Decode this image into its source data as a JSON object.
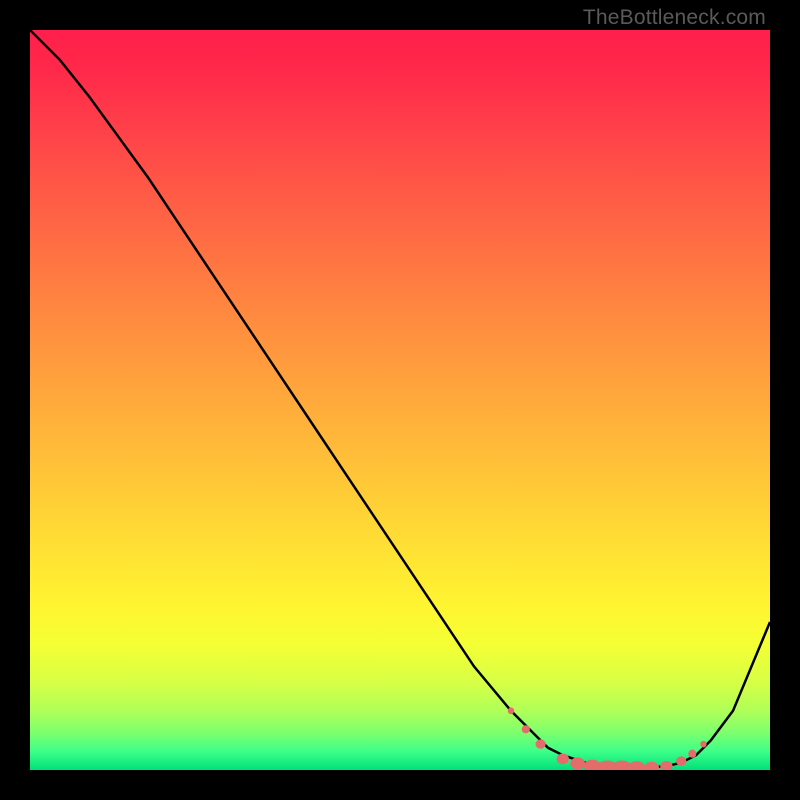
{
  "watermark": "TheBottleneck.com",
  "chart_data": {
    "type": "line",
    "title": "",
    "xlabel": "",
    "ylabel": "",
    "xlim": [
      0,
      100
    ],
    "ylim": [
      0,
      100
    ],
    "grid": false,
    "legend": false,
    "series": [
      {
        "name": "curve",
        "x": [
          0,
          4,
          8,
          12,
          16,
          20,
          28,
          36,
          44,
          52,
          60,
          65,
          68,
          70,
          72,
          75,
          78,
          80,
          83,
          86,
          88,
          90,
          92,
          95,
          100
        ],
        "y": [
          100,
          96,
          91,
          85.5,
          80,
          74,
          62,
          50,
          38,
          26,
          14,
          8,
          5,
          3,
          2,
          1,
          0.5,
          0.3,
          0.3,
          0.5,
          1,
          2,
          4,
          8,
          20
        ]
      }
    ],
    "markers": [
      {
        "x": 65,
        "y": 8
      },
      {
        "x": 67,
        "y": 5.5
      },
      {
        "x": 69,
        "y": 3.5
      },
      {
        "x": 72,
        "y": 1.5
      },
      {
        "x": 74,
        "y": 0.9
      },
      {
        "x": 76,
        "y": 0.5
      },
      {
        "x": 78,
        "y": 0.3
      },
      {
        "x": 80,
        "y": 0.3
      },
      {
        "x": 82,
        "y": 0.3
      },
      {
        "x": 84,
        "y": 0.3
      },
      {
        "x": 86,
        "y": 0.5
      },
      {
        "x": 88,
        "y": 1.2
      },
      {
        "x": 89.5,
        "y": 2.2
      },
      {
        "x": 91,
        "y": 3.5
      }
    ],
    "marker_style": {
      "color": "#e46d6b",
      "radius_range": [
        4,
        9
      ]
    }
  }
}
